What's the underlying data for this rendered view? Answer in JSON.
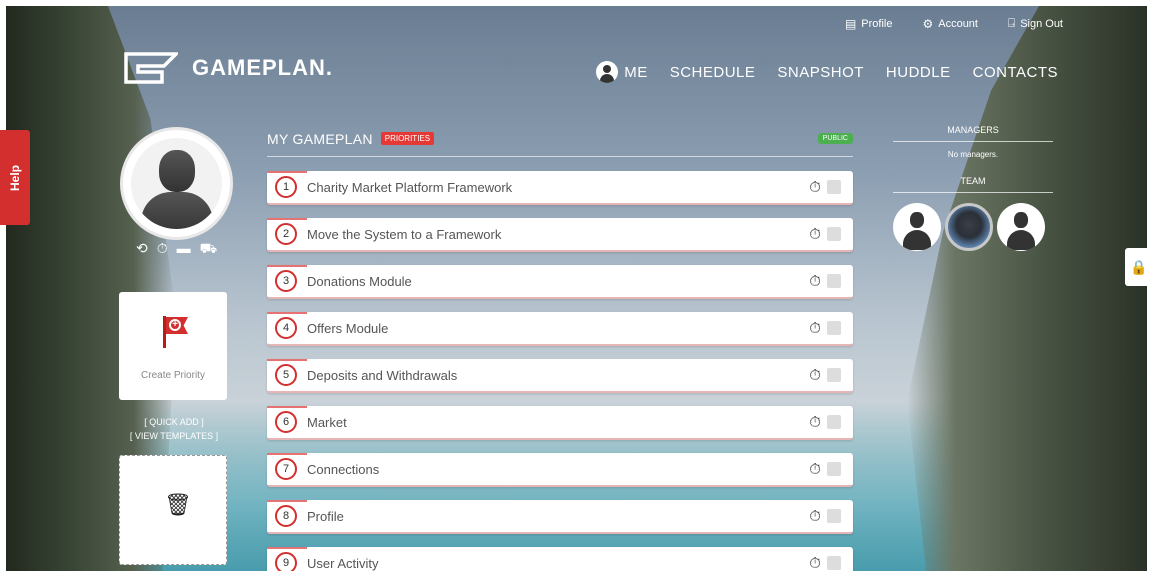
{
  "topbar": {
    "profile": "Profile",
    "account": "Account",
    "signout": "Sign Out",
    "profile_icon": "id-card-icon",
    "account_icon": "gear-icon",
    "signout_icon": "door-exit-icon"
  },
  "brand": {
    "name": "GAMEPLAN."
  },
  "nav": {
    "me": "ME",
    "schedule": "SCHEDULE",
    "snapshot": "SNAPSHOT",
    "huddle": "HUDDLE",
    "contacts": "CONTACTS"
  },
  "help": {
    "label": "Help"
  },
  "sidebar_left": {
    "create_priority": "Create Priority",
    "quick_add": "[ QUICK ADD ]",
    "view_templates": "[ VIEW TEMPLATES ]"
  },
  "main": {
    "title": "MY GAMEPLAN",
    "priorities_badge": "PRIORITIES",
    "public_badge": "PUBLIC",
    "priorities": [
      {
        "num": "1",
        "name": "Charity Market Platform Framework"
      },
      {
        "num": "2",
        "name": "Move the System to a Framework"
      },
      {
        "num": "3",
        "name": "Donations Module"
      },
      {
        "num": "4",
        "name": "Offers Module"
      },
      {
        "num": "5",
        "name": "Deposits and Withdrawals"
      },
      {
        "num": "6",
        "name": "Market"
      },
      {
        "num": "7",
        "name": "Connections"
      },
      {
        "num": "8",
        "name": "Profile"
      },
      {
        "num": "9",
        "name": "User Activity"
      }
    ]
  },
  "sidebar_right": {
    "managers_heading": "MANAGERS",
    "no_managers": "No managers.",
    "team_heading": "TEAM"
  },
  "colors": {
    "accent_red": "#d32f2f",
    "public_green": "#4caf50"
  }
}
